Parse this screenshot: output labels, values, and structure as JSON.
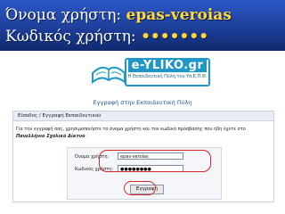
{
  "header": {
    "username_label": "Όνομα χρήστη:",
    "username_value": "epas-veroias",
    "password_label": "Κωδικός χρήστη:",
    "password_value": "•••••••"
  },
  "logo": {
    "wordmark": "e-YLIKO.gr",
    "tagline": "Η Εκπαιδευτική Πύλη του Υπ.Ε.Π.Θ."
  },
  "page_title": "Εγγραφή στην Εκπαιδευτική Πύλη",
  "panel": {
    "heading": "Είσοδος / Εγγραφή Εκπαιδευτικού",
    "instructions": "Για την εγγραφή σας, χρησιμοποιήστε το όνομα χρήστη και τον κωδικό πρόσβασης που ήδη έχετε στο",
    "network_name": "Πανελλήνιο Σχολικό Δίκτυο",
    "form": {
      "username_label": "Όνομα χρήστη:",
      "username_value": "epas-veroias",
      "password_label": "Κωδικός χρήστη:",
      "password_value": "●●●●●●●●",
      "submit_label": "Εγγραφή"
    }
  },
  "colors": {
    "header_bg": "#1e3f9a",
    "header_value": "#ffd93a",
    "brand": "#1f98c9",
    "highlight": "#d8262a"
  }
}
